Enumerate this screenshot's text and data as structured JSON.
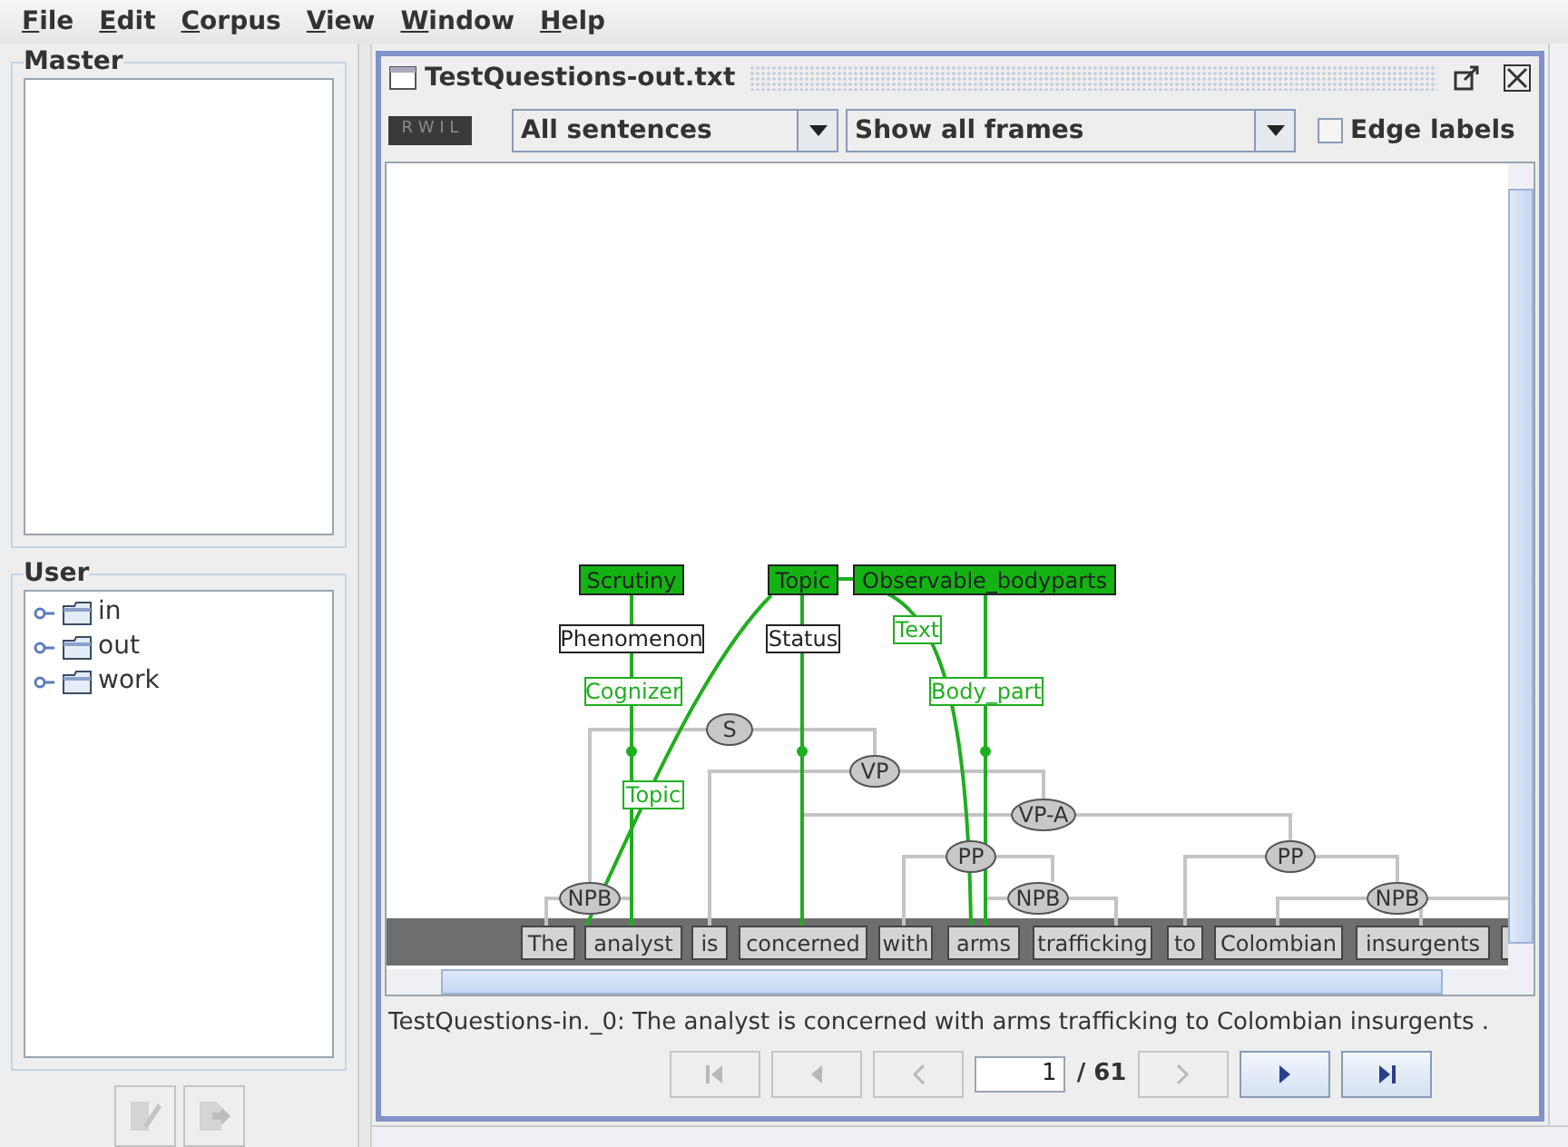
{
  "menu": [
    "File",
    "Edit",
    "Corpus",
    "View",
    "Window",
    "Help"
  ],
  "master": {
    "title": "Master"
  },
  "user": {
    "title": "User",
    "items": [
      {
        "label": "in",
        "expanded": false
      },
      {
        "label": "out",
        "expanded": false
      },
      {
        "label": "work",
        "expanded": false
      }
    ]
  },
  "frame": {
    "title": "TestQuestions-out.txt",
    "toolbar": {
      "mode": "R W I L",
      "sentence_filter": "All sentences",
      "frame_filter": "Show all frames",
      "edge_labels": {
        "label": "Edge labels",
        "checked": false
      }
    },
    "diagram": {
      "frames": [
        "Scrutiny",
        "Topic",
        "Observable_bodyparts"
      ],
      "roles": [
        {
          "label": "Phenomenon",
          "kind": "plain"
        },
        {
          "label": "Status",
          "kind": "plain"
        },
        {
          "label": "Cognizer",
          "kind": "element"
        },
        {
          "label": "Text",
          "kind": "element"
        },
        {
          "label": "Body_part",
          "kind": "element"
        },
        {
          "label": "Topic",
          "kind": "element"
        }
      ],
      "constituents": [
        "S",
        "VP",
        "VP-A",
        "PP",
        "NPB",
        "NPB",
        "PP",
        "NPB"
      ],
      "tokens": [
        "The",
        "analyst",
        "is",
        "concerned",
        "with",
        "arms",
        "trafficking",
        "to",
        "Colombian",
        "insurgents"
      ]
    },
    "sentence": "TestQuestions-in._0: The analyst is concerned with arms trafficking to Colombian insurgents .",
    "nav": {
      "buttons": [
        {
          "kind": "first",
          "disabled": true
        },
        {
          "kind": "prev",
          "disabled": true
        },
        {
          "kind": "back",
          "disabled": true
        },
        {
          "kind": "forward",
          "disabled": true
        },
        {
          "kind": "next",
          "disabled": false
        },
        {
          "kind": "last",
          "disabled": false
        }
      ],
      "page": "1",
      "total": "/ 61"
    }
  }
}
